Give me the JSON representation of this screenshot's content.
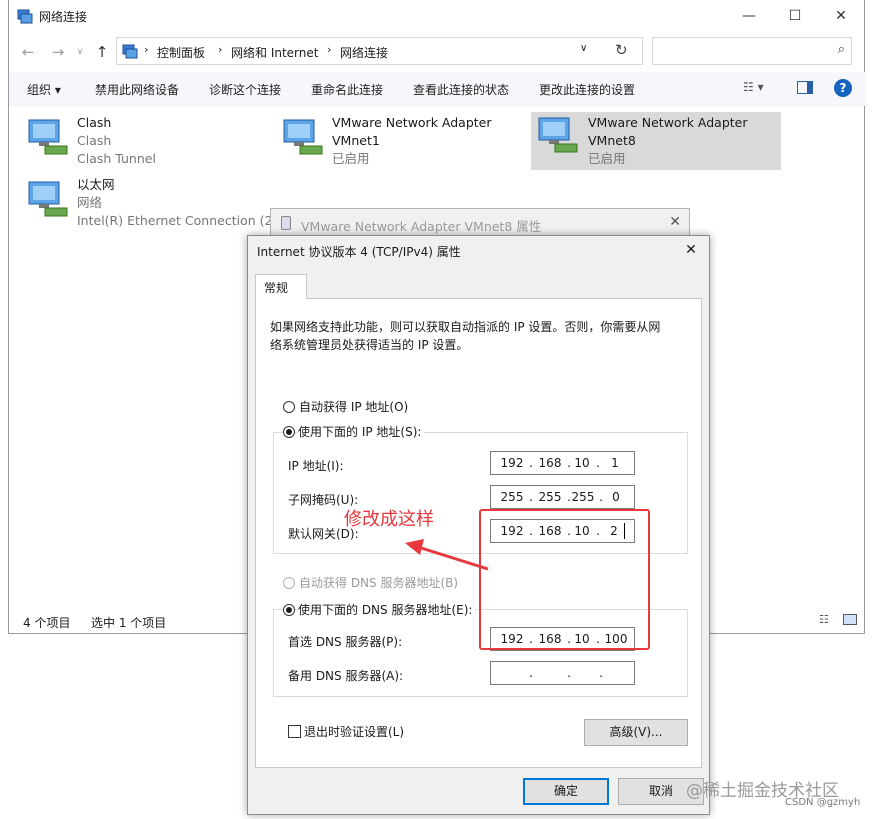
{
  "explorer": {
    "title": "网络连接",
    "breadcrumb": [
      "控制面板",
      "网络和 Internet",
      "网络连接"
    ],
    "toolbar": [
      "组织 ▾",
      "禁用此网络设备",
      "诊断这个连接",
      "重命名此连接",
      "查看此连接的状态",
      "更改此连接的设置"
    ],
    "adapters": [
      {
        "name": "Clash",
        "line2": "Clash",
        "line3": "Clash Tunnel"
      },
      {
        "name": "VMware Network Adapter",
        "line2": "VMnet1",
        "line3": "已启用"
      },
      {
        "name": "VMware Network Adapter",
        "line2": "VMnet8",
        "line3": "已启用",
        "selected": true
      },
      {
        "name": "以太网",
        "line2": "网络",
        "line3": "Intel(R) Ethernet Connection (2..."
      }
    ],
    "status_count": "4 个项目",
    "status_selected": "选中 1 个项目"
  },
  "prop_window": {
    "title": "VMware Network Adapter VMnet8 属性"
  },
  "dialog": {
    "title": "Internet 协议版本 4 (TCP/IPv4) 属性",
    "tab": "常规",
    "description_line1": "如果网络支持此功能，则可以获取自动指派的 IP 设置。否则，你需要从网",
    "description_line2": "络系统管理员处获得适当的 IP 设置。",
    "auto_ip": "自动获得 IP 地址(O)",
    "manual_ip": "使用下面的 IP 地址(S):",
    "ip_label": "IP 地址(I):",
    "mask_label": "子网掩码(U):",
    "gateway_label": "默认网关(D):",
    "ip": [
      "192",
      "168",
      "10",
      "1"
    ],
    "mask": [
      "255",
      "255",
      "255",
      "0"
    ],
    "gateway": [
      "192",
      "168",
      "10",
      "2"
    ],
    "auto_dns": "自动获得 DNS 服务器地址(B)",
    "manual_dns": "使用下面的 DNS 服务器地址(E):",
    "preferred_dns_label": "首选 DNS 服务器(P):",
    "alternate_dns_label": "备用 DNS 服务器(A):",
    "preferred_dns": [
      "192",
      "168",
      "10",
      "100"
    ],
    "alternate_dns": [
      "",
      "",
      "",
      ""
    ],
    "validate_on_exit": "退出时验证设置(L)",
    "advanced": "高级(V)...",
    "ok": "确定",
    "cancel": "取消"
  },
  "annotation": {
    "text": "修改成这样",
    "color": "#e8383d"
  },
  "watermark": {
    "line1": "@稀土掘金技术社区",
    "line2": "CSDN @gzmyh"
  }
}
